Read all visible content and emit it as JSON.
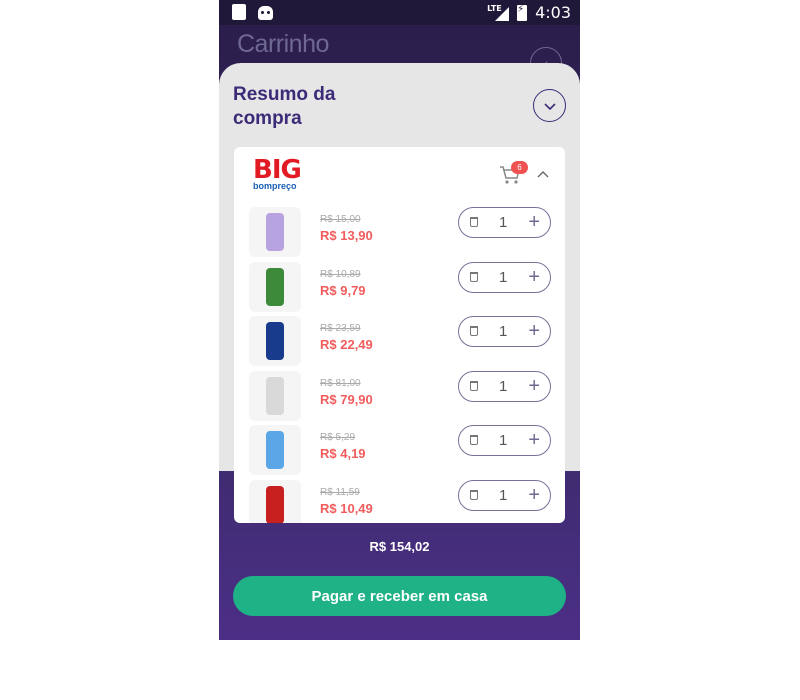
{
  "status_bar": {
    "time": "4:03",
    "network": "LTE"
  },
  "header": {
    "title": "Carrinho"
  },
  "summary": {
    "title": "Resumo da compra"
  },
  "store": {
    "logo_main": "BIG",
    "logo_sub": "bompreço",
    "cart_count": "6"
  },
  "items": [
    {
      "old_price": "R$ 15,00",
      "new_price": "R$ 13,90",
      "qty": "1",
      "color": "#b7a3e0"
    },
    {
      "old_price": "R$ 10,89",
      "new_price": "R$ 9,79",
      "qty": "1",
      "color": "#3d8a3a"
    },
    {
      "old_price": "R$ 23,59",
      "new_price": "R$ 22,49",
      "qty": "1",
      "color": "#183b8c"
    },
    {
      "old_price": "R$ 81,00",
      "new_price": "R$ 79,90",
      "qty": "1",
      "color": "#d9d9d9"
    },
    {
      "old_price": "R$ 5,29",
      "new_price": "R$ 4,19",
      "qty": "1",
      "color": "#5aa6e6"
    },
    {
      "old_price": "R$ 11,59",
      "new_price": "R$ 10,49",
      "qty": "1",
      "color": "#c8201f"
    }
  ],
  "footer": {
    "total": "R$ 154,02",
    "pay_label": "Pagar e receber em casa"
  }
}
